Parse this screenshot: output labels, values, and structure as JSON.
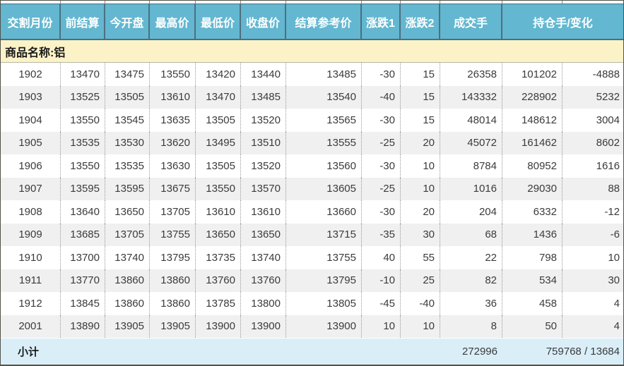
{
  "table": {
    "headers": [
      "交割月份",
      "前结算",
      "今开盘",
      "最高价",
      "最低价",
      "收盘价",
      "结算参考价",
      "涨跌1",
      "涨跌2",
      "成交手",
      "持仓手/变化"
    ],
    "group_label": "商品名称:铝",
    "rows": [
      [
        "1902",
        "13470",
        "13475",
        "13550",
        "13420",
        "13440",
        "13485",
        "-30",
        "15",
        "26358",
        "101202",
        "-4888"
      ],
      [
        "1903",
        "13525",
        "13505",
        "13610",
        "13470",
        "13485",
        "13540",
        "-40",
        "15",
        "143332",
        "228902",
        "5232"
      ],
      [
        "1904",
        "13550",
        "13545",
        "13635",
        "13505",
        "13520",
        "13565",
        "-30",
        "15",
        "48014",
        "148612",
        "3004"
      ],
      [
        "1905",
        "13535",
        "13530",
        "13620",
        "13495",
        "13510",
        "13555",
        "-25",
        "20",
        "45072",
        "161462",
        "8602"
      ],
      [
        "1906",
        "13550",
        "13535",
        "13630",
        "13505",
        "13520",
        "13560",
        "-30",
        "10",
        "8784",
        "80952",
        "1616"
      ],
      [
        "1907",
        "13595",
        "13595",
        "13675",
        "13550",
        "13570",
        "13605",
        "-25",
        "10",
        "1016",
        "29030",
        "88"
      ],
      [
        "1908",
        "13640",
        "13650",
        "13705",
        "13610",
        "13610",
        "13660",
        "-30",
        "20",
        "204",
        "6332",
        "-12"
      ],
      [
        "1909",
        "13685",
        "13705",
        "13755",
        "13650",
        "13650",
        "13715",
        "-35",
        "30",
        "68",
        "1436",
        "-6"
      ],
      [
        "1910",
        "13700",
        "13740",
        "13795",
        "13735",
        "13740",
        "13755",
        "40",
        "55",
        "22",
        "798",
        "10"
      ],
      [
        "1911",
        "13770",
        "13860",
        "13860",
        "13760",
        "13760",
        "13795",
        "-10",
        "25",
        "82",
        "534",
        "30"
      ],
      [
        "1912",
        "13845",
        "13860",
        "13860",
        "13785",
        "13800",
        "13805",
        "-45",
        "-40",
        "36",
        "458",
        "4"
      ],
      [
        "2001",
        "13890",
        "13905",
        "13905",
        "13900",
        "13900",
        "13900",
        "10",
        "10",
        "8",
        "50",
        "4"
      ]
    ],
    "subtotal": {
      "label": "小计",
      "volume_total": "272996",
      "open_interest_total": "759768 / 13684"
    }
  },
  "colors": {
    "header_bg": "#63b7d0",
    "header_divider": "#4d6f80",
    "header_text": "#ffffff",
    "group_bg": "#fbf2c7",
    "alt_row_bg": "#f0f0f0",
    "subtotal_bg": "#daeef8",
    "text": "#3b3b3b",
    "divider": "#999999",
    "outer_border": "#52524a"
  }
}
